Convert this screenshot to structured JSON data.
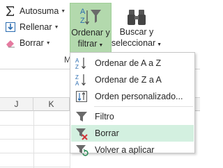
{
  "ribbon": {
    "autosum_label": "Autosuma",
    "fill_label": "Rellenar",
    "clear_label": "Borrar",
    "sort_filter_line1": "Ordenar y",
    "sort_filter_line2": "filtrar",
    "find_select_line1": "Buscar y",
    "find_select_line2": "seleccionar",
    "group_label_visible": "M",
    "accent_color": "#b3d9ad"
  },
  "sheet": {
    "columns": [
      "J",
      "K"
    ]
  },
  "menu": {
    "items": [
      {
        "label": "Ordenar de A a Z",
        "icon": "sort-a-to-z-icon"
      },
      {
        "label": "Ordenar de Z a A",
        "icon": "sort-z-to-a-icon"
      },
      {
        "label": "Orden personalizado...",
        "icon": "custom-sort-icon"
      },
      {
        "label": "Filtro",
        "icon": "filter-icon"
      },
      {
        "label": "Borrar",
        "icon": "clear-filter-icon",
        "hovered": true
      },
      {
        "label": "Volver a aplicar",
        "icon": "reapply-filter-icon"
      }
    ],
    "hover_color": "#d3f0e0"
  }
}
